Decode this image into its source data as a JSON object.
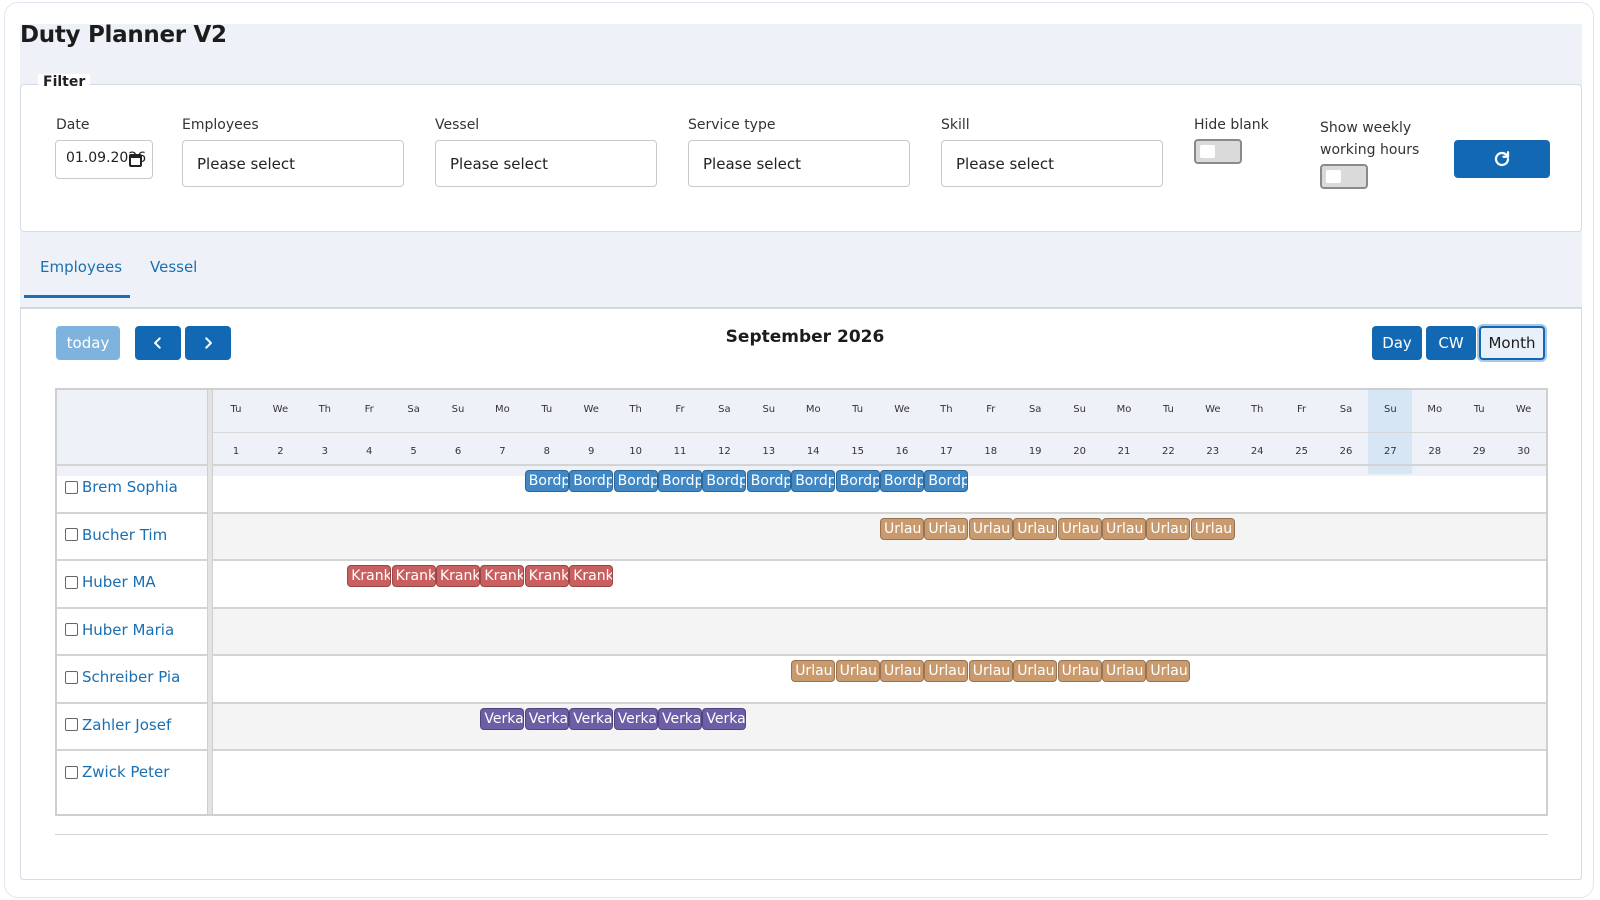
{
  "app": {
    "title": "Duty Planner V2"
  },
  "filter": {
    "legend": "Filter",
    "date": {
      "label": "Date",
      "value": "01.09.2026"
    },
    "employees": {
      "label": "Employees",
      "placeholder": "Please select"
    },
    "vessel": {
      "label": "Vessel",
      "placeholder": "Please select"
    },
    "service_type": {
      "label": "Service type",
      "placeholder": "Please select"
    },
    "skill": {
      "label": "Skill",
      "placeholder": "Please select"
    },
    "hide_blank": {
      "label": "Hide blank",
      "on": false
    },
    "show_weekly": {
      "label_line1": "Show weekly",
      "label_line2": "working hours",
      "on": false
    },
    "refresh_icon": "refresh-icon"
  },
  "tabs": [
    {
      "label": "Employees",
      "active": true
    },
    {
      "label": "Vessel",
      "active": false
    }
  ],
  "calendar": {
    "today_label": "today",
    "prev_icon": "chevron-left-icon",
    "next_icon": "chevron-right-icon",
    "title": "September 2026",
    "views": [
      "Day",
      "CW",
      "Month"
    ],
    "active_view": "Month",
    "today_day": 27,
    "days": [
      {
        "wd": "Tu",
        "d": "1"
      },
      {
        "wd": "We",
        "d": "2"
      },
      {
        "wd": "Th",
        "d": "3"
      },
      {
        "wd": "Fr",
        "d": "4"
      },
      {
        "wd": "Sa",
        "d": "5"
      },
      {
        "wd": "Su",
        "d": "6"
      },
      {
        "wd": "Mo",
        "d": "7"
      },
      {
        "wd": "Tu",
        "d": "8"
      },
      {
        "wd": "We",
        "d": "9"
      },
      {
        "wd": "Th",
        "d": "10"
      },
      {
        "wd": "Fr",
        "d": "11"
      },
      {
        "wd": "Sa",
        "d": "12"
      },
      {
        "wd": "Su",
        "d": "13"
      },
      {
        "wd": "Mo",
        "d": "14"
      },
      {
        "wd": "Tu",
        "d": "15"
      },
      {
        "wd": "We",
        "d": "16"
      },
      {
        "wd": "Th",
        "d": "17"
      },
      {
        "wd": "Fr",
        "d": "18"
      },
      {
        "wd": "Sa",
        "d": "19"
      },
      {
        "wd": "Su",
        "d": "20"
      },
      {
        "wd": "Mo",
        "d": "21"
      },
      {
        "wd": "Tu",
        "d": "22"
      },
      {
        "wd": "We",
        "d": "23"
      },
      {
        "wd": "Th",
        "d": "24"
      },
      {
        "wd": "Fr",
        "d": "25"
      },
      {
        "wd": "Sa",
        "d": "26"
      },
      {
        "wd": "Su",
        "d": "27"
      },
      {
        "wd": "Mo",
        "d": "28"
      },
      {
        "wd": "Tu",
        "d": "29"
      },
      {
        "wd": "We",
        "d": "30"
      }
    ],
    "event_colors": {
      "Bordp": "#3f88c5",
      "Urlau": "#c99a6e",
      "Krank": "#c9605f",
      "Verka": "#6d5ea6"
    },
    "rows": [
      {
        "name": "Brem Sophia",
        "events": [
          {
            "label": "Bordp",
            "start": 8,
            "end": 17
          }
        ]
      },
      {
        "name": "Bucher Tim",
        "events": [
          {
            "label": "Urlau",
            "start": 16,
            "end": 23
          }
        ]
      },
      {
        "name": "Huber MA",
        "events": [
          {
            "label": "Krank",
            "start": 4,
            "end": 9
          }
        ]
      },
      {
        "name": "Huber Maria",
        "events": []
      },
      {
        "name": "Schreiber Pia",
        "events": [
          {
            "label": "Urlau",
            "start": 14,
            "end": 22
          }
        ]
      },
      {
        "name": "Zahler Josef",
        "events": [
          {
            "label": "Verka",
            "start": 7,
            "end": 12
          }
        ]
      },
      {
        "name": "Zwick Peter",
        "events": []
      }
    ]
  }
}
